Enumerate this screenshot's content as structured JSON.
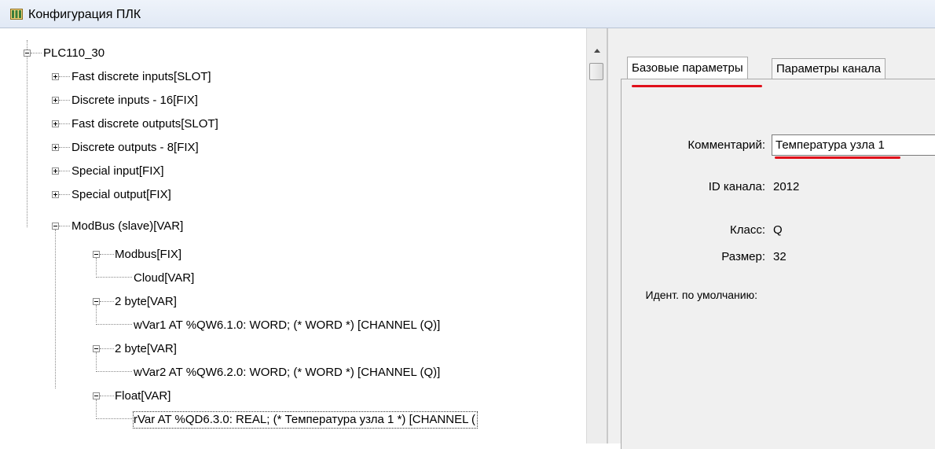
{
  "window": {
    "title": "Конфигурация ПЛК",
    "icon": "plc-config-icon"
  },
  "tree": {
    "root": "PLC110_30",
    "nodes": [
      {
        "label": "Fast discrete inputs[SLOT]",
        "expander": "plus"
      },
      {
        "label": "Discrete inputs - 16[FIX]",
        "expander": "plus"
      },
      {
        "label": "Fast discrete outputs[SLOT]",
        "expander": "plus"
      },
      {
        "label": "Discrete outputs - 8[FIX]",
        "expander": "plus"
      },
      {
        "label": "Special input[FIX]",
        "expander": "plus"
      },
      {
        "label": "Special output[FIX]",
        "expander": "plus"
      },
      {
        "label": "ModBus (slave)[VAR]",
        "expander": "minus"
      },
      {
        "label": "Modbus[FIX]",
        "expander": "minus"
      },
      {
        "label": "Cloud[VAR]",
        "expander": "none"
      },
      {
        "label": "2 byte[VAR]",
        "expander": "minus"
      },
      {
        "label": "wVar1 AT %QW6.1.0: WORD; (* WORD *) [CHANNEL (Q)]",
        "expander": "none"
      },
      {
        "label": "2 byte[VAR]",
        "expander": "minus"
      },
      {
        "label": "wVar2 AT %QW6.2.0: WORD; (* WORD *) [CHANNEL (Q)]",
        "expander": "none"
      },
      {
        "label": "Float[VAR]",
        "expander": "minus"
      },
      {
        "label": "rVar AT %QD6.3.0: REAL; (* Температура узла 1 *) [CHANNEL (",
        "expander": "none",
        "selected": true
      }
    ]
  },
  "tabs": [
    {
      "label": "Базовые параметры",
      "active": true
    },
    {
      "label": "Параметры канала",
      "active": false
    }
  ],
  "channel": {
    "comment_label": "Комментарий:",
    "comment_value": "Температура узла 1",
    "id_label": "ID канала:",
    "id_value": "2012",
    "class_label": "Класс:",
    "class_value": "Q",
    "size_label": "Размер:",
    "size_value": "32",
    "default_id_label": "Идент. по умолчанию:"
  },
  "colors": {
    "highlight_underline": "#e0101a",
    "panel_background": "#f0f0f0"
  }
}
